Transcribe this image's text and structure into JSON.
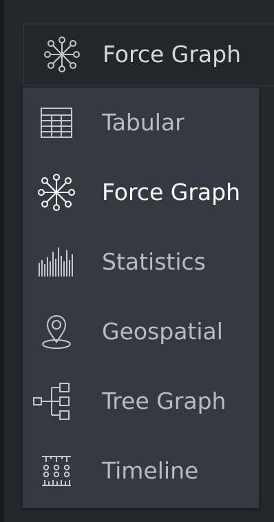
{
  "selector": {
    "selected_label": "Force Graph",
    "icon": "force-graph-icon"
  },
  "menu": {
    "items": [
      {
        "label": "Tabular",
        "icon": "table-icon",
        "selected": false
      },
      {
        "label": "Force Graph",
        "icon": "force-graph-icon",
        "selected": true
      },
      {
        "label": "Statistics",
        "icon": "statistics-icon",
        "selected": false
      },
      {
        "label": "Geospatial",
        "icon": "map-pin-icon",
        "selected": false
      },
      {
        "label": "Tree Graph",
        "icon": "tree-graph-icon",
        "selected": false
      },
      {
        "label": "Timeline",
        "icon": "timeline-icon",
        "selected": false
      }
    ]
  },
  "colors": {
    "background": "#25282b",
    "dropdown_bg": "#343a40",
    "text_default": "#b7bcc2",
    "text_active": "#ffffff"
  }
}
